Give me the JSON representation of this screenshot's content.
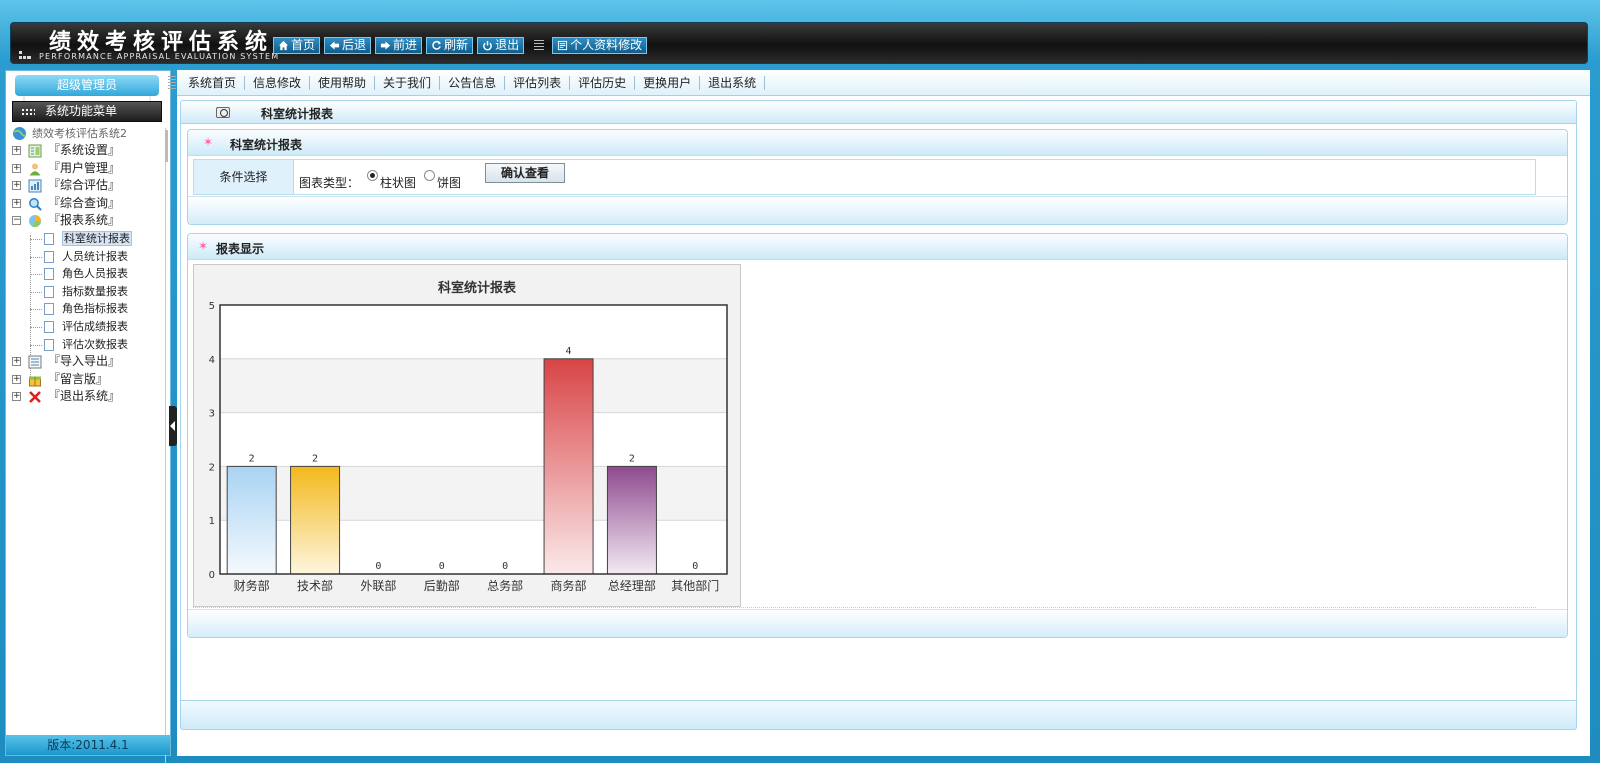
{
  "app": {
    "title": "绩效考核评估系统",
    "subtitle": "PERFORMANCE APPRAISAL EVALUATION SYSTEM"
  },
  "header_buttons": [
    {
      "label": "首页",
      "icon": "home-icon"
    },
    {
      "label": "后退",
      "icon": "arrow-left-icon"
    },
    {
      "label": "前进",
      "icon": "arrow-right-icon"
    },
    {
      "label": "刷新",
      "icon": "refresh-icon"
    },
    {
      "label": "退出",
      "icon": "power-icon"
    }
  ],
  "profile_button": {
    "label": "个人资料修改",
    "icon": "profile-icon"
  },
  "sidebar": {
    "admin_label": "超级管理员",
    "menu_title": "系统功能菜单",
    "root": "绩效考核评估系统2",
    "groups_top": [
      {
        "label": "『系统设置』",
        "icon": "settings-icon",
        "expanded": false
      },
      {
        "label": "『用户管理』",
        "icon": "user-icon",
        "expanded": false
      },
      {
        "label": "『综合评估』",
        "icon": "evaluate-icon",
        "expanded": false
      },
      {
        "label": "『综合查询』",
        "icon": "search-icon",
        "expanded": false
      },
      {
        "label": "『报表系统』",
        "icon": "pie-chart-icon",
        "expanded": true
      }
    ],
    "report_items": [
      "科室统计报表",
      "人员统计报表",
      "角色人员报表",
      "指标数量报表",
      "角色指标报表",
      "评估成绩报表",
      "评估次数报表"
    ],
    "selected_report": 0,
    "groups_bottom": [
      {
        "label": "『导入导出』",
        "icon": "import-export-icon",
        "expanded": false
      },
      {
        "label": "『留言版』",
        "icon": "gift-icon",
        "expanded": false
      },
      {
        "label": "『退出系统』",
        "icon": "close-icon",
        "expanded": false
      }
    ],
    "version": "版本:2011.4.1"
  },
  "topnav": [
    "系统首页",
    "信息修改",
    "使用帮助",
    "关于我们",
    "公告信息",
    "评估列表",
    "评估历史",
    "更换用户",
    "退出系统"
  ],
  "page_title": "科室统计报表",
  "condition_panel": {
    "title": "科室统计报表",
    "row_label": "条件选择",
    "chart_type_label": "图表类型：",
    "options": [
      "柱状图",
      "饼图"
    ],
    "selected_option": 0,
    "confirm_label": "确认查看"
  },
  "report_panel": {
    "title": "报表显示"
  },
  "chart_data": {
    "type": "bar",
    "title": "科室统计报表",
    "categories": [
      "财务部",
      "技术部",
      "外联部",
      "后勤部",
      "总务部",
      "商务部",
      "总经理部",
      "其他部门"
    ],
    "values": [
      2,
      2,
      0,
      0,
      0,
      4,
      2,
      0
    ],
    "ylim": [
      0,
      5
    ],
    "yticks": [
      0,
      1,
      2,
      3,
      4,
      5
    ],
    "colors": [
      [
        "#a9d3f3",
        "#f4f9fd"
      ],
      [
        "#f4b81c",
        "#fdf6df"
      ],
      [
        "#cccccc",
        "#ffffff"
      ],
      [
        "#cccccc",
        "#ffffff"
      ],
      [
        "#cccccc",
        "#ffffff"
      ],
      [
        "#d94446",
        "#fbe9ea"
      ],
      [
        "#8e4a8f",
        "#f3eaf3"
      ],
      [
        "#cccccc",
        "#ffffff"
      ]
    ],
    "grid": true,
    "xlabel": "",
    "ylabel": ""
  }
}
